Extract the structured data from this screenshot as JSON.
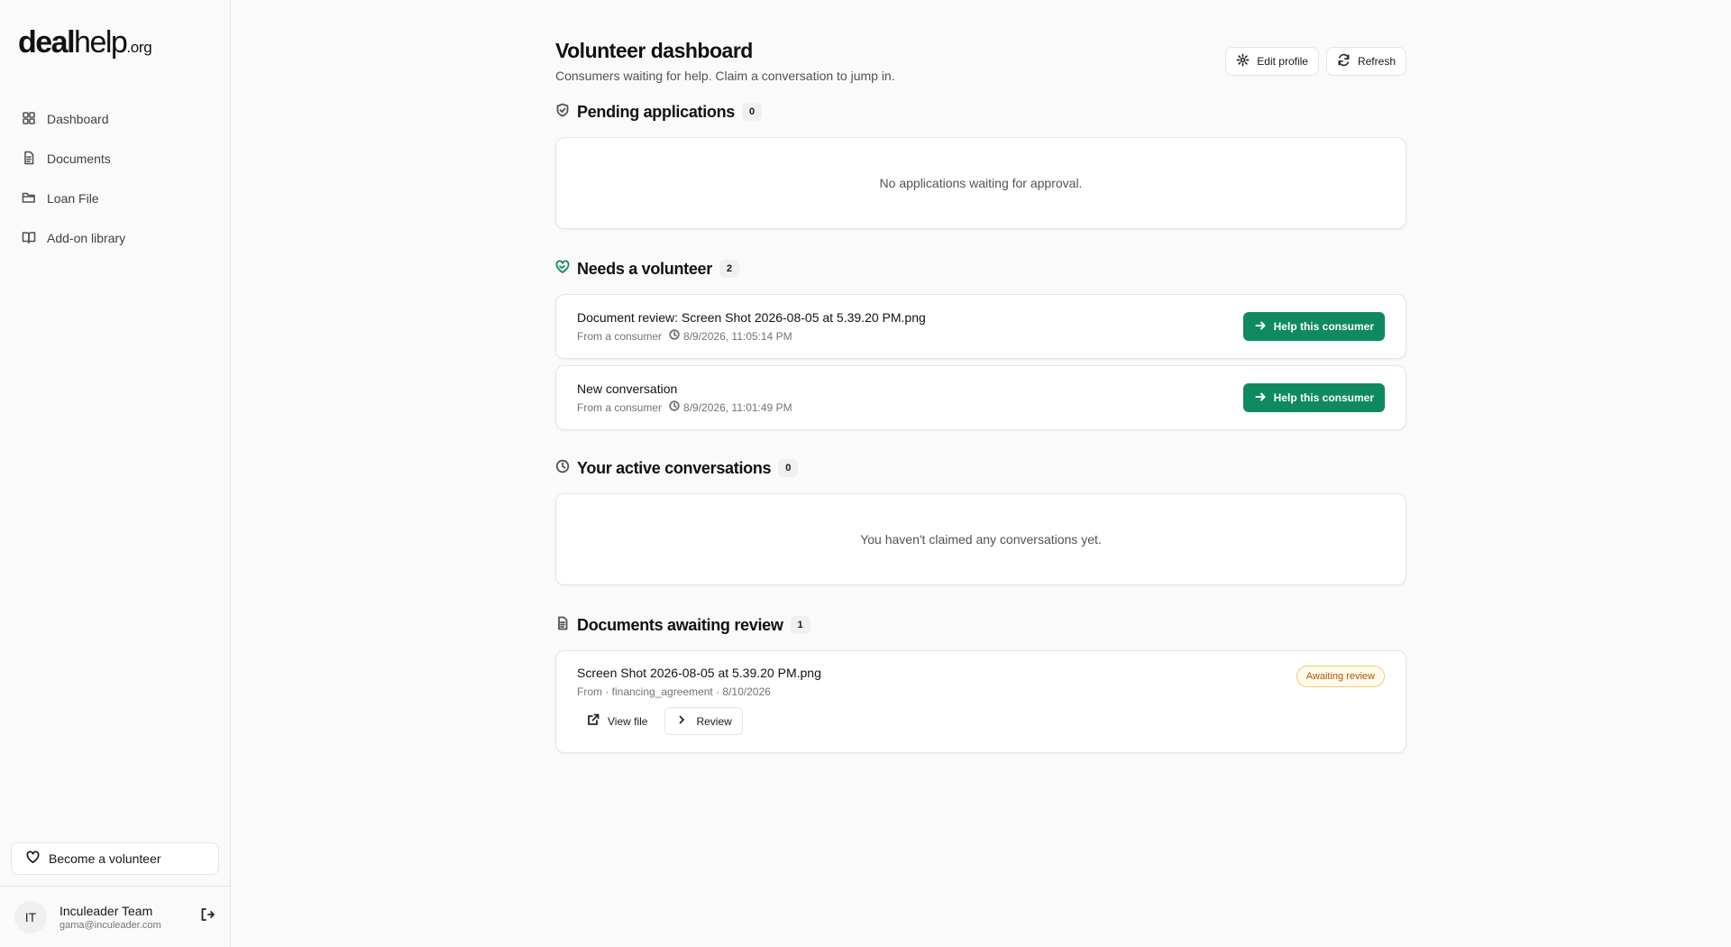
{
  "brand": {
    "part1": "deal",
    "part2": "help",
    "part3": ".org"
  },
  "sidebar": {
    "items": [
      {
        "label": "Dashboard",
        "icon": "grid-icon"
      },
      {
        "label": "Documents",
        "icon": "file-icon"
      },
      {
        "label": "Loan File",
        "icon": "folder-icon"
      },
      {
        "label": "Add-on library",
        "icon": "book-icon"
      }
    ],
    "become_volunteer": "Become a volunteer",
    "user": {
      "initials": "IT",
      "name": "Inculeader Team",
      "email": "gama@inculeader.com"
    }
  },
  "header": {
    "title": "Volunteer dashboard",
    "subtitle": "Consumers waiting for help. Claim a conversation to jump in.",
    "edit_profile": "Edit profile",
    "refresh": "Refresh"
  },
  "pending": {
    "title": "Pending applications",
    "count": "0",
    "empty": "No applications waiting for approval."
  },
  "needs": {
    "title": "Needs a volunteer",
    "count": "2",
    "items": [
      {
        "title": "Document review: Screen Shot 2026-08-05 at 5.39.20 PM.png",
        "from": "From a consumer",
        "time": "8/9/2026, 11:05:14 PM",
        "action": "Help this consumer"
      },
      {
        "title": "New conversation",
        "from": "From a consumer",
        "time": "8/9/2026, 11:01:49 PM",
        "action": "Help this consumer"
      }
    ]
  },
  "active": {
    "title": "Your active conversations",
    "count": "0",
    "empty": "You haven't claimed any conversations yet."
  },
  "documents": {
    "title": "Documents awaiting review",
    "count": "1",
    "items": [
      {
        "title": "Screen Shot 2026-08-05 at 5.39.20 PM.png",
        "meta": "From · financing_agreement · 8/10/2026",
        "status": "Awaiting review",
        "view": "View file",
        "review": "Review"
      }
    ]
  },
  "colors": {
    "accent": "#0f8a5f",
    "badge_warning": "#b45309"
  }
}
